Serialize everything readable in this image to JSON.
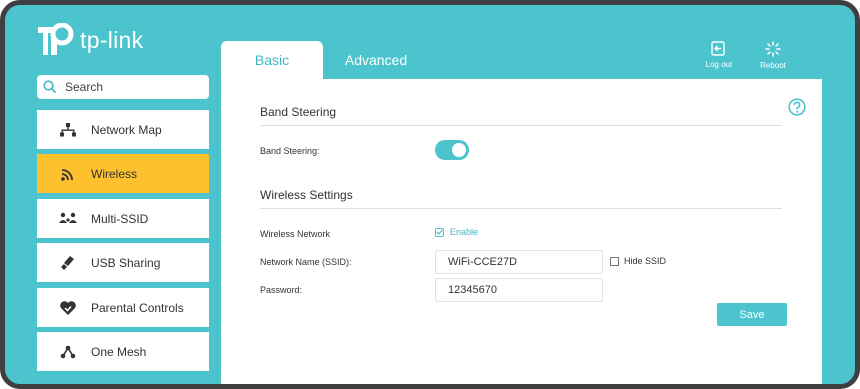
{
  "brand": {
    "logo_text": "tp-link",
    "accent": "#4cc4ce",
    "active": "#fcc12d"
  },
  "search": {
    "placeholder": "Search",
    "icon": "search-icon"
  },
  "sidebar": {
    "items": [
      {
        "label": "Network Map",
        "icon": "network-map-icon",
        "active": false
      },
      {
        "label": "Wireless",
        "icon": "wireless-icon",
        "active": true
      },
      {
        "label": "Multi-SSID",
        "icon": "multi-ssid-icon",
        "active": false
      },
      {
        "label": "USB Sharing",
        "icon": "usb-icon",
        "active": false
      },
      {
        "label": "Parental Controls",
        "icon": "parental-controls-icon",
        "active": false
      },
      {
        "label": "One Mesh",
        "icon": "onemesh-icon",
        "active": false
      }
    ]
  },
  "tabs": [
    {
      "label": "Basic",
      "active": true
    },
    {
      "label": "Advanced",
      "active": false
    }
  ],
  "header": {
    "logout_label": "Log out",
    "reboot_label": "Reboot"
  },
  "main": {
    "band_steering": {
      "title": "Band Steering",
      "label": "Band Steering:",
      "enabled": true
    },
    "wireless_settings": {
      "title": "Wireless Settings",
      "network_label": "Wireless Network",
      "enable_label": "Enable",
      "enable_checked": true,
      "ssid_label": "Network Name (SSID):",
      "ssid_value": "WiFi-CCE27D",
      "hide_ssid_label": "Hide SSID",
      "hide_ssid_checked": false,
      "password_label": "Password:",
      "password_value": "12345670"
    },
    "save_label": "Save"
  }
}
